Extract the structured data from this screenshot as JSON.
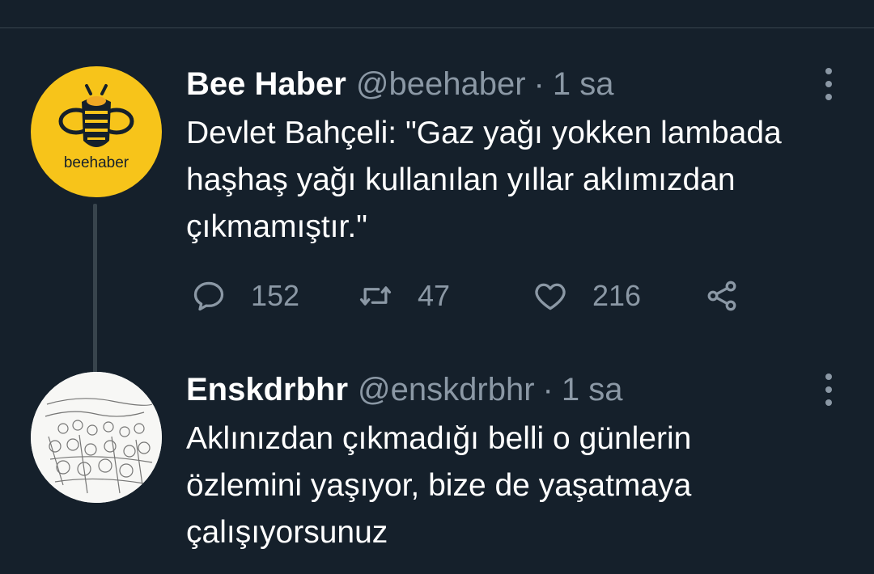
{
  "tweets": [
    {
      "name": "Bee Haber",
      "handle": "@beehaber",
      "separator": "·",
      "time": "1 sa",
      "avatar_brand": "beehaber",
      "text": "Devlet Bahçeli: \"Gaz yağı yokken lambada haşhaş yağı kullanılan yıllar aklımızdan çıkmamıştır.\"",
      "stats": {
        "replies": "152",
        "retweets": "47",
        "likes": "216"
      }
    },
    {
      "name": "Enskdrbhr",
      "handle": "@enskdrbhr",
      "separator": "·",
      "time": "1 sa",
      "text": "Aklınızdan çıkmadığı belli o günlerin özlemini yaşıyor, bize de yaşatmaya çalışıyorsunuz"
    }
  ],
  "icons": {
    "reply": "reply-icon",
    "retweet": "retweet-icon",
    "like": "heart-icon",
    "share": "share-icon",
    "more": "more-options-icon"
  },
  "colors": {
    "background": "#15202b",
    "muted": "#8b98a5",
    "divider": "#38444d",
    "brand_yellow": "#f7c41a"
  }
}
